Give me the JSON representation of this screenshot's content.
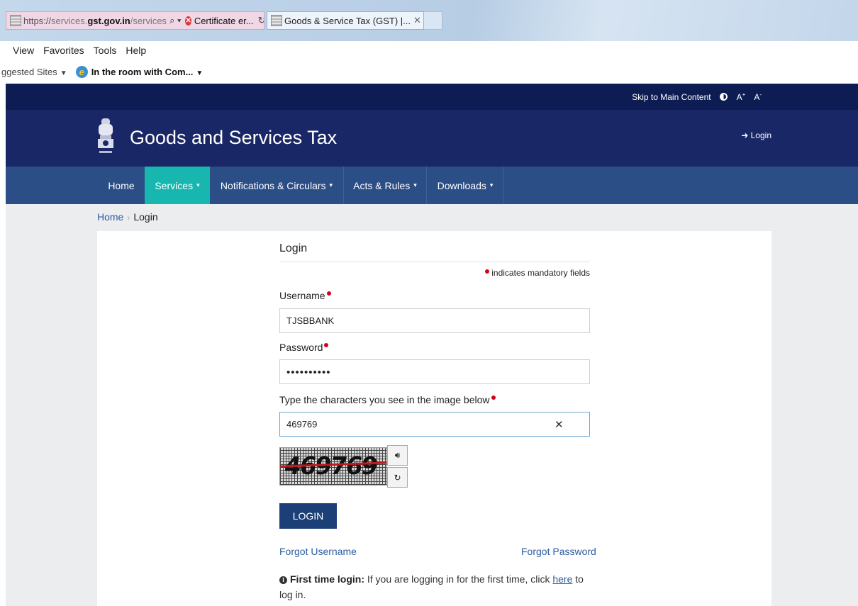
{
  "browser": {
    "url_protocol": "https://",
    "url_domain_prefix": "services.",
    "url_domain": "gst.gov.in",
    "url_path": "/services",
    "cert_error": "Certificate er...",
    "tab_title": "Goods & Service Tax (GST) |...",
    "menu": [
      "View",
      "Favorites",
      "Tools",
      "Help"
    ],
    "favorites_suggested": "ggested Sites",
    "favorites_item": "In the room with Com..."
  },
  "topbar": {
    "skip": "Skip to Main Content",
    "a_plus": "A",
    "a_minus": "A"
  },
  "header": {
    "title": "Goods and Services Tax",
    "login": "Login"
  },
  "nav": [
    {
      "label": "Home"
    },
    {
      "label": "Services"
    },
    {
      "label": "Notifications & Circulars"
    },
    {
      "label": "Acts & Rules"
    },
    {
      "label": "Downloads"
    }
  ],
  "breadcrumb": {
    "home": "Home",
    "current": "Login"
  },
  "form": {
    "title": "Login",
    "mandatory_note": "indicates mandatory fields",
    "username_label": "Username",
    "username_value": "TJSBBANK",
    "password_label": "Password",
    "password_mask": "••••••••••",
    "captcha_label": "Type the characters you see in the image below",
    "captcha_value": "469769",
    "captcha_image_text": "469769",
    "login_button": "LOGIN",
    "forgot_username": "Forgot Username",
    "forgot_password": "Forgot Password",
    "first_time_bold": "First time login:",
    "first_time_text": "If you are logging in for the first time, click",
    "first_time_link": "here",
    "first_time_tail": "to log in."
  },
  "colors": {
    "header_dark": "#0d1d53",
    "header": "#1a2766",
    "nav": "#2c4e86",
    "nav_active": "#17b7b0",
    "button": "#1c3f78",
    "link": "#2c5ca0",
    "required": "#d0021b"
  }
}
